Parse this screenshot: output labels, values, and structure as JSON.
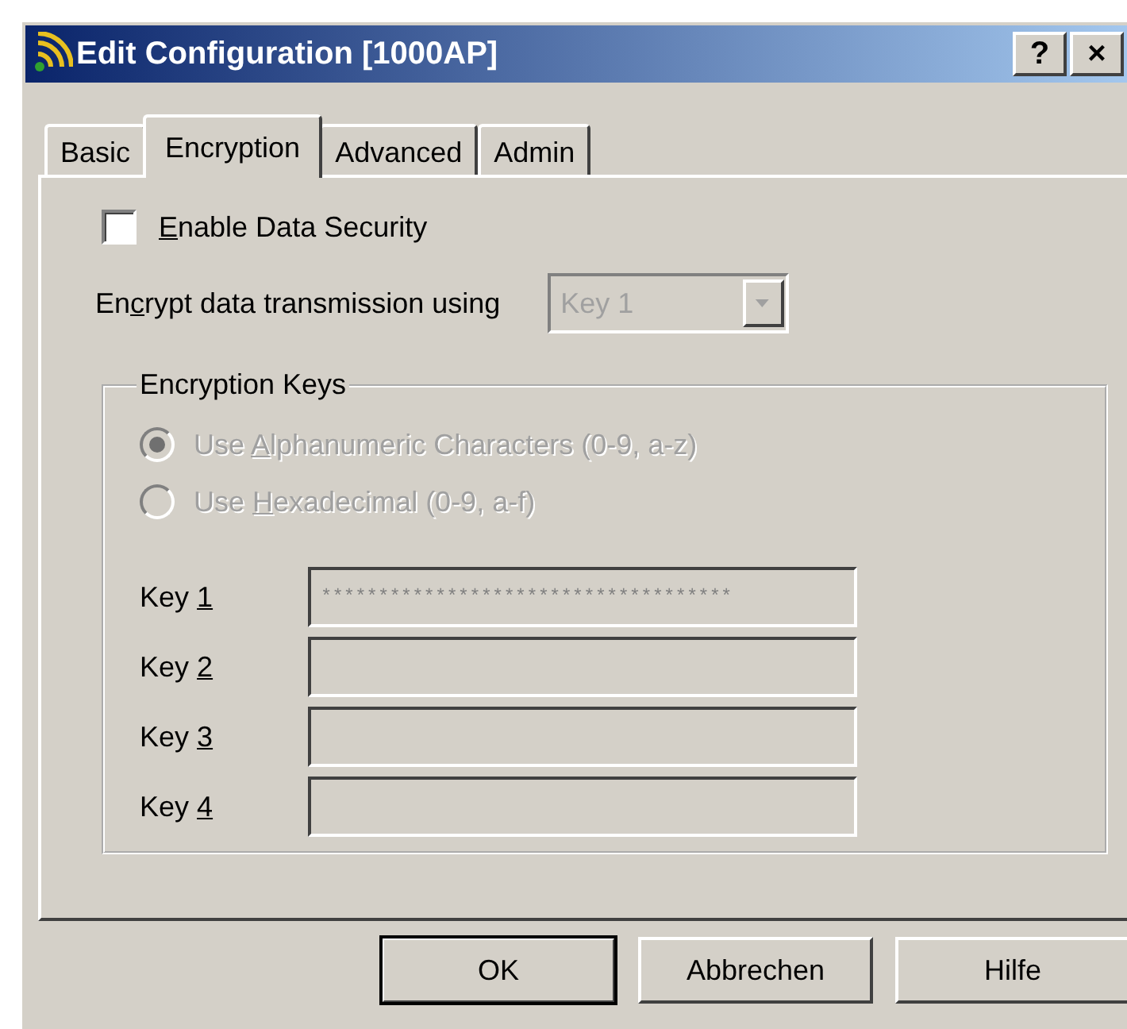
{
  "window": {
    "title": "Edit Configuration [1000AP]",
    "help_button": "?",
    "close_button": "×"
  },
  "tabs": [
    {
      "label": "Basic",
      "selected": false
    },
    {
      "label": "Encryption",
      "selected": true
    },
    {
      "label": "Advanced",
      "selected": false
    },
    {
      "label": "Admin",
      "selected": false
    }
  ],
  "enable_security": {
    "key": "E",
    "post": "nable Data Security",
    "checked": false
  },
  "encrypt_using": {
    "pre": "En",
    "key": "c",
    "post": "rypt data transmission using",
    "value": "Key 1",
    "disabled": true
  },
  "encryption_keys": {
    "title": "Encryption Keys",
    "options": [
      {
        "pre": "Use ",
        "key": "A",
        "post": "lphanumeric Characters (0-9, a-z)",
        "selected": true,
        "disabled": true
      },
      {
        "pre": "Use ",
        "key": "H",
        "post": "exadecimal (0-9, a-f)",
        "selected": false,
        "disabled": true
      }
    ],
    "keys": [
      {
        "pre": "Key ",
        "key": "1",
        "value": "************************************",
        "disabled": true
      },
      {
        "pre": "Key ",
        "key": "2",
        "disabled": true
      },
      {
        "pre": "Key ",
        "key": "3",
        "disabled": true
      },
      {
        "pre": "Key ",
        "key": "4",
        "disabled": true
      }
    ]
  },
  "buttons": [
    {
      "label": "OK",
      "default": true
    },
    {
      "label": "Abbrechen",
      "default": false
    },
    {
      "label": "Hilfe",
      "default": false
    }
  ]
}
